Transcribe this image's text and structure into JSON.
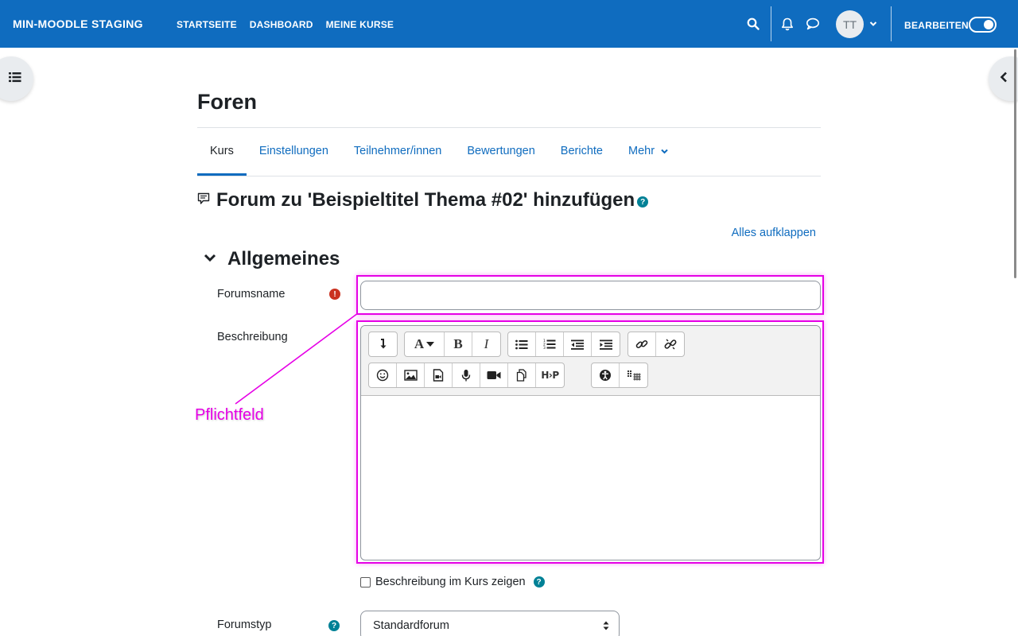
{
  "navbar": {
    "brand": "MIN-MOODLE STAGING",
    "links": [
      "STARTSEITE",
      "DASHBOARD",
      "MEINE KURSE"
    ],
    "avatar_initials": "TT",
    "edit_mode_label": "BEARBEITEN",
    "edit_mode_on": true,
    "icons": [
      "search-icon",
      "bell-icon",
      "chat-icon",
      "chevron-down-icon"
    ]
  },
  "page": {
    "title": "Foren",
    "tabs": [
      {
        "label": "Kurs",
        "active": true
      },
      {
        "label": "Einstellungen"
      },
      {
        "label": "Teilnehmer/innen"
      },
      {
        "label": "Bewertungen"
      },
      {
        "label": "Berichte"
      },
      {
        "label": "Mehr"
      }
    ],
    "heading": "Forum zu 'Beispieltitel Thema #02' hinzufügen",
    "expand_all": "Alles aufklappen"
  },
  "form": {
    "section_title": "Allgemeines",
    "forum_name_label": "Forumsname",
    "forum_name_value": "",
    "description_label": "Beschreibung",
    "show_description_label": "Beschreibung im Kurs zeigen",
    "show_description_checked": false,
    "forum_type_label": "Forumstyp",
    "forum_type_value": "Standardforum"
  },
  "annotation": {
    "text": "Pflichtfeld",
    "color": "#e600e6"
  },
  "colors": {
    "brand": "#0f6cbf",
    "required": "#ca3120",
    "help": "#008196"
  }
}
